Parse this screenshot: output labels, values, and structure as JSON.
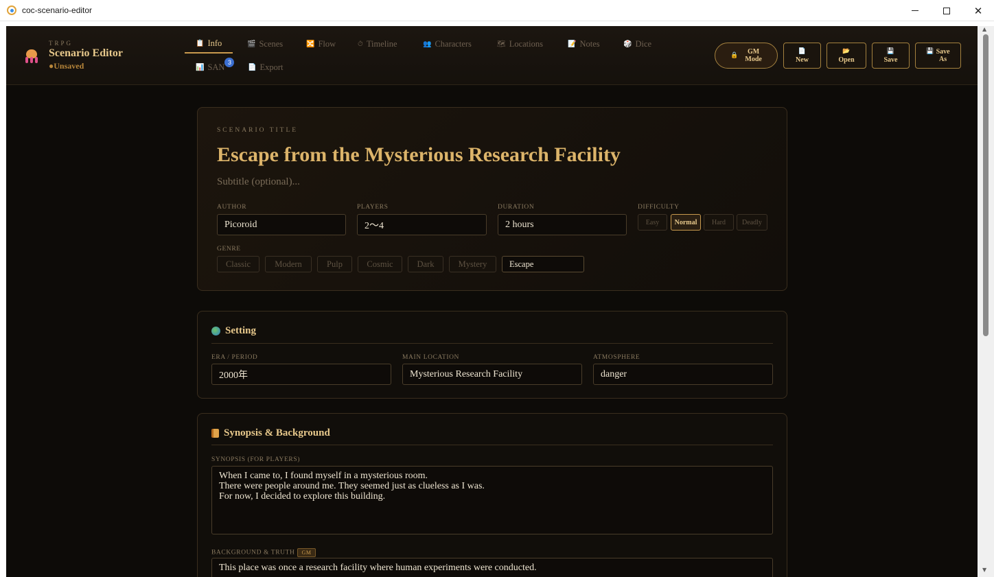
{
  "window": {
    "title": "coc-scenario-editor"
  },
  "brand": {
    "kicker": "TRPG",
    "name": "Scenario Editor",
    "status": "●Unsaved"
  },
  "tabs": [
    {
      "label": "Info",
      "icon": "📋"
    },
    {
      "label": "Scenes",
      "icon": "🎬"
    },
    {
      "label": "Flow",
      "icon": "🔀"
    },
    {
      "label": "Timeline",
      "icon": "⏱"
    },
    {
      "label": "Characters",
      "icon": "👥"
    },
    {
      "label": "Locations",
      "icon": "🗺"
    },
    {
      "label": "Notes",
      "icon": "📝"
    },
    {
      "label": "Dice",
      "icon": "🎲"
    },
    {
      "label": "SAN",
      "icon": "📊",
      "badge": "3"
    },
    {
      "label": "Export",
      "icon": "📄"
    }
  ],
  "header_buttons": {
    "gm": {
      "line1": "GM",
      "line2": "Mode",
      "icon": "🔒"
    },
    "new": {
      "label": "New",
      "icon": "📄"
    },
    "open": {
      "label": "Open",
      "icon": "📂"
    },
    "save": {
      "label": "Save",
      "icon": "💾"
    },
    "save_as": {
      "line1": "Save",
      "line2": "As",
      "icon": "💾"
    }
  },
  "title_card": {
    "kicker": "SCENARIO TITLE",
    "title": "Escape from the Mysterious Research Facility",
    "subtitle_placeholder": "Subtitle (optional)...",
    "author_label": "AUTHOR",
    "author": "Picoroid",
    "players_label": "PLAYERS",
    "players": "2～4",
    "duration_label": "DURATION",
    "duration": "2 hours",
    "difficulty_label": "DIFFICULTY",
    "difficulty_options": [
      "Easy",
      "Normal",
      "Hard",
      "Deadly"
    ],
    "difficulty_selected": "Normal",
    "genre_label": "GENRE",
    "genre_options": [
      "Classic",
      "Modern",
      "Pulp",
      "Cosmic",
      "Dark",
      "Mystery"
    ],
    "genre_custom": "Escape"
  },
  "setting": {
    "heading": "Setting",
    "era_label": "ERA / PERIOD",
    "era": "2000年",
    "location_label": "MAIN LOCATION",
    "location": "Mysterious Research Facility",
    "atmosphere_label": "ATMOSPHERE",
    "atmosphere": "danger"
  },
  "synopsis": {
    "heading": "Synopsis & Background",
    "synopsis_label": "SYNOPSIS (FOR PLAYERS)",
    "synopsis_text": "When I came to, I found myself in a mysterious room.\nThere were people around me. They seemed just as clueless as I was.\nFor now, I decided to explore this building.",
    "background_label": "BACKGROUND & TRUTH",
    "background_badge": "GM",
    "background_text": "This place was once a research facility where human experiments were conducted."
  }
}
